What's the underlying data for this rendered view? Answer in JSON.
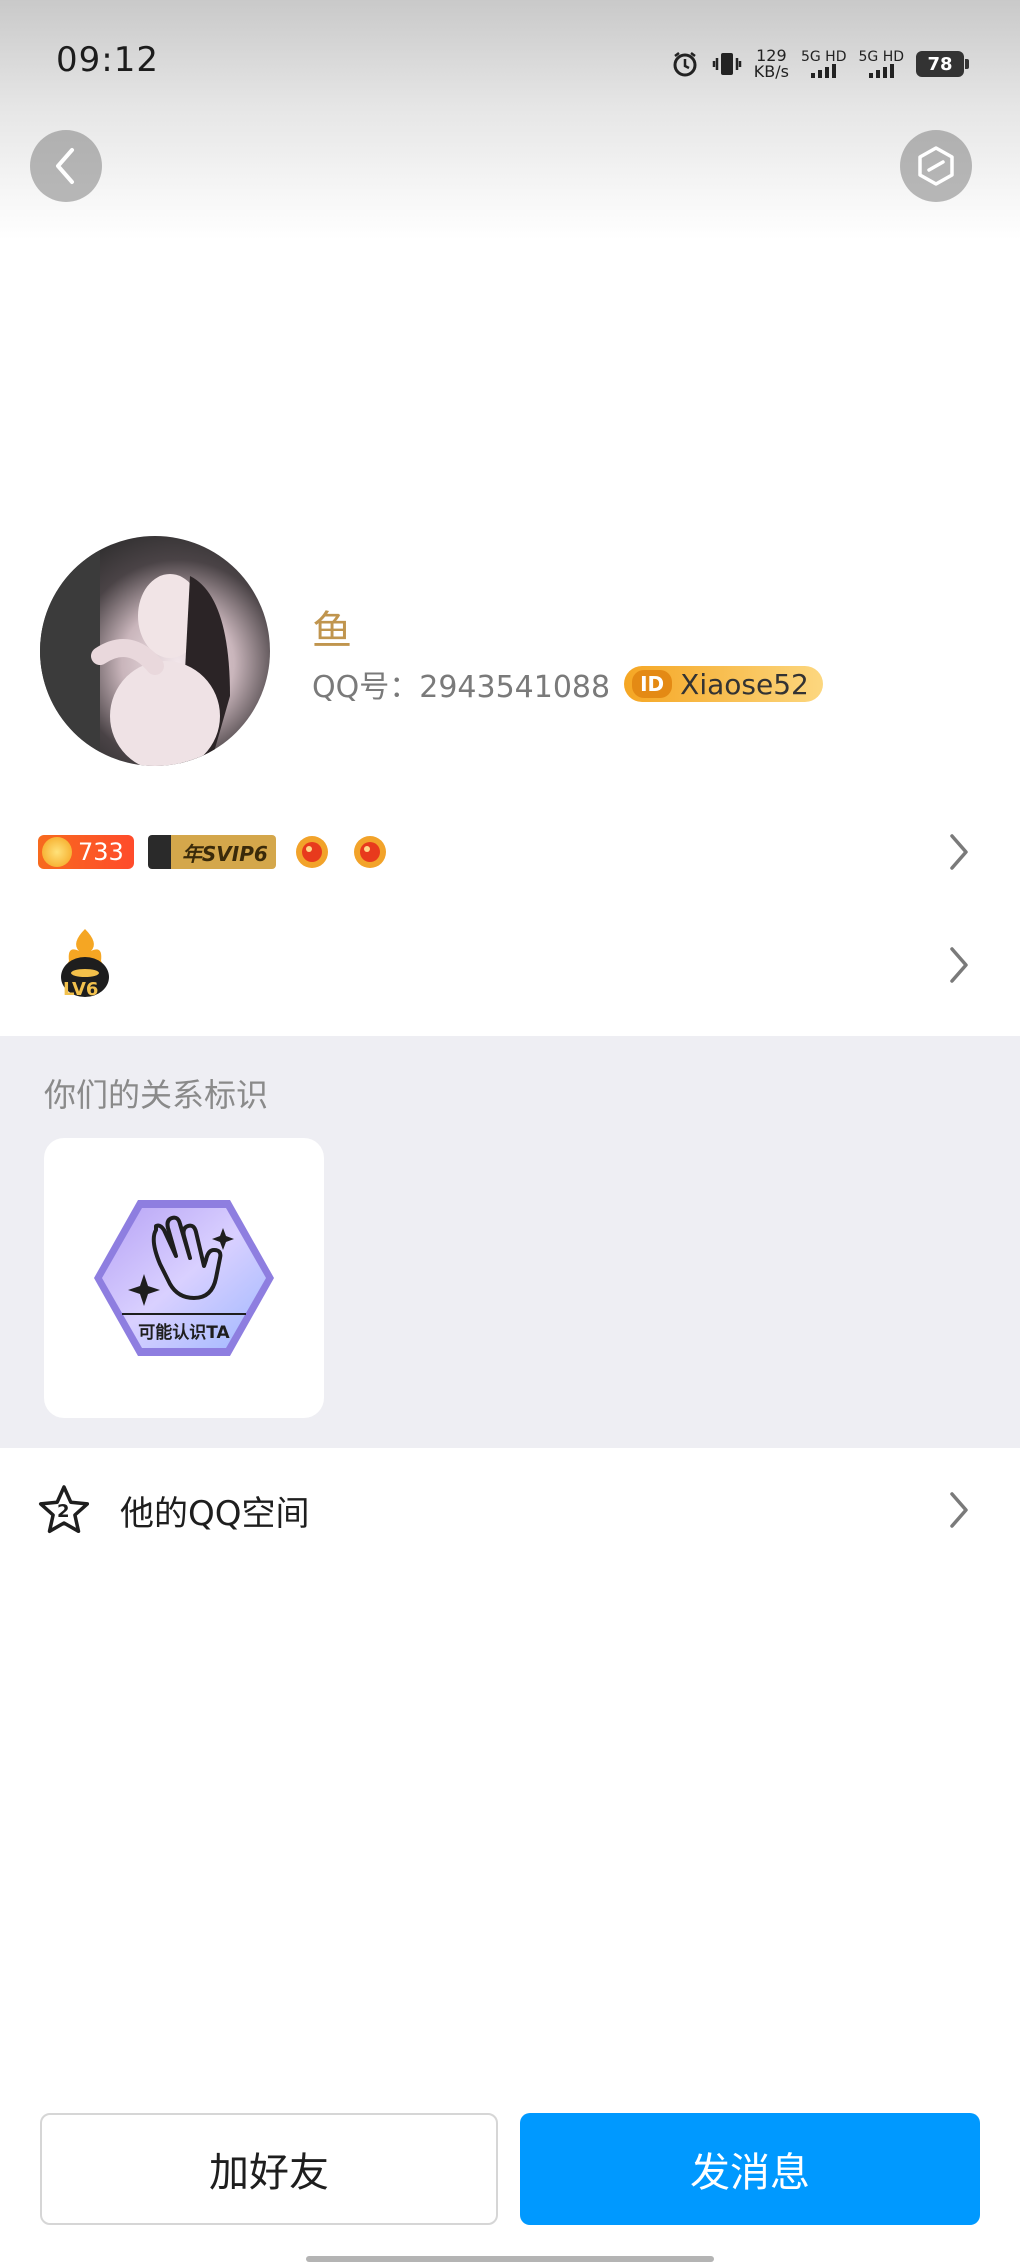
{
  "status_bar": {
    "time": "09:12",
    "speed_value": "129",
    "speed_unit": "KB/s",
    "sim1_label": "5G HD",
    "sim2_label": "5G HD",
    "battery": "78"
  },
  "profile": {
    "nickname": "鱼",
    "qq_label": "QQ号：2943541088",
    "id_chip": "ID",
    "id_value": "Xiaose52",
    "coin_value": "733",
    "svip_label": "年SVIP6",
    "level_label": "LV6"
  },
  "relationship": {
    "title": "你们的关系标识",
    "badge_text": "可能认识TA"
  },
  "qzone": {
    "label": "他的QQ空间",
    "icon_number": "2"
  },
  "actions": {
    "add_friend": "加好友",
    "send_message": "发消息"
  },
  "colors": {
    "accent": "#0099ff",
    "nickname": "#c0954e",
    "section_bg": "#eeeef3"
  }
}
